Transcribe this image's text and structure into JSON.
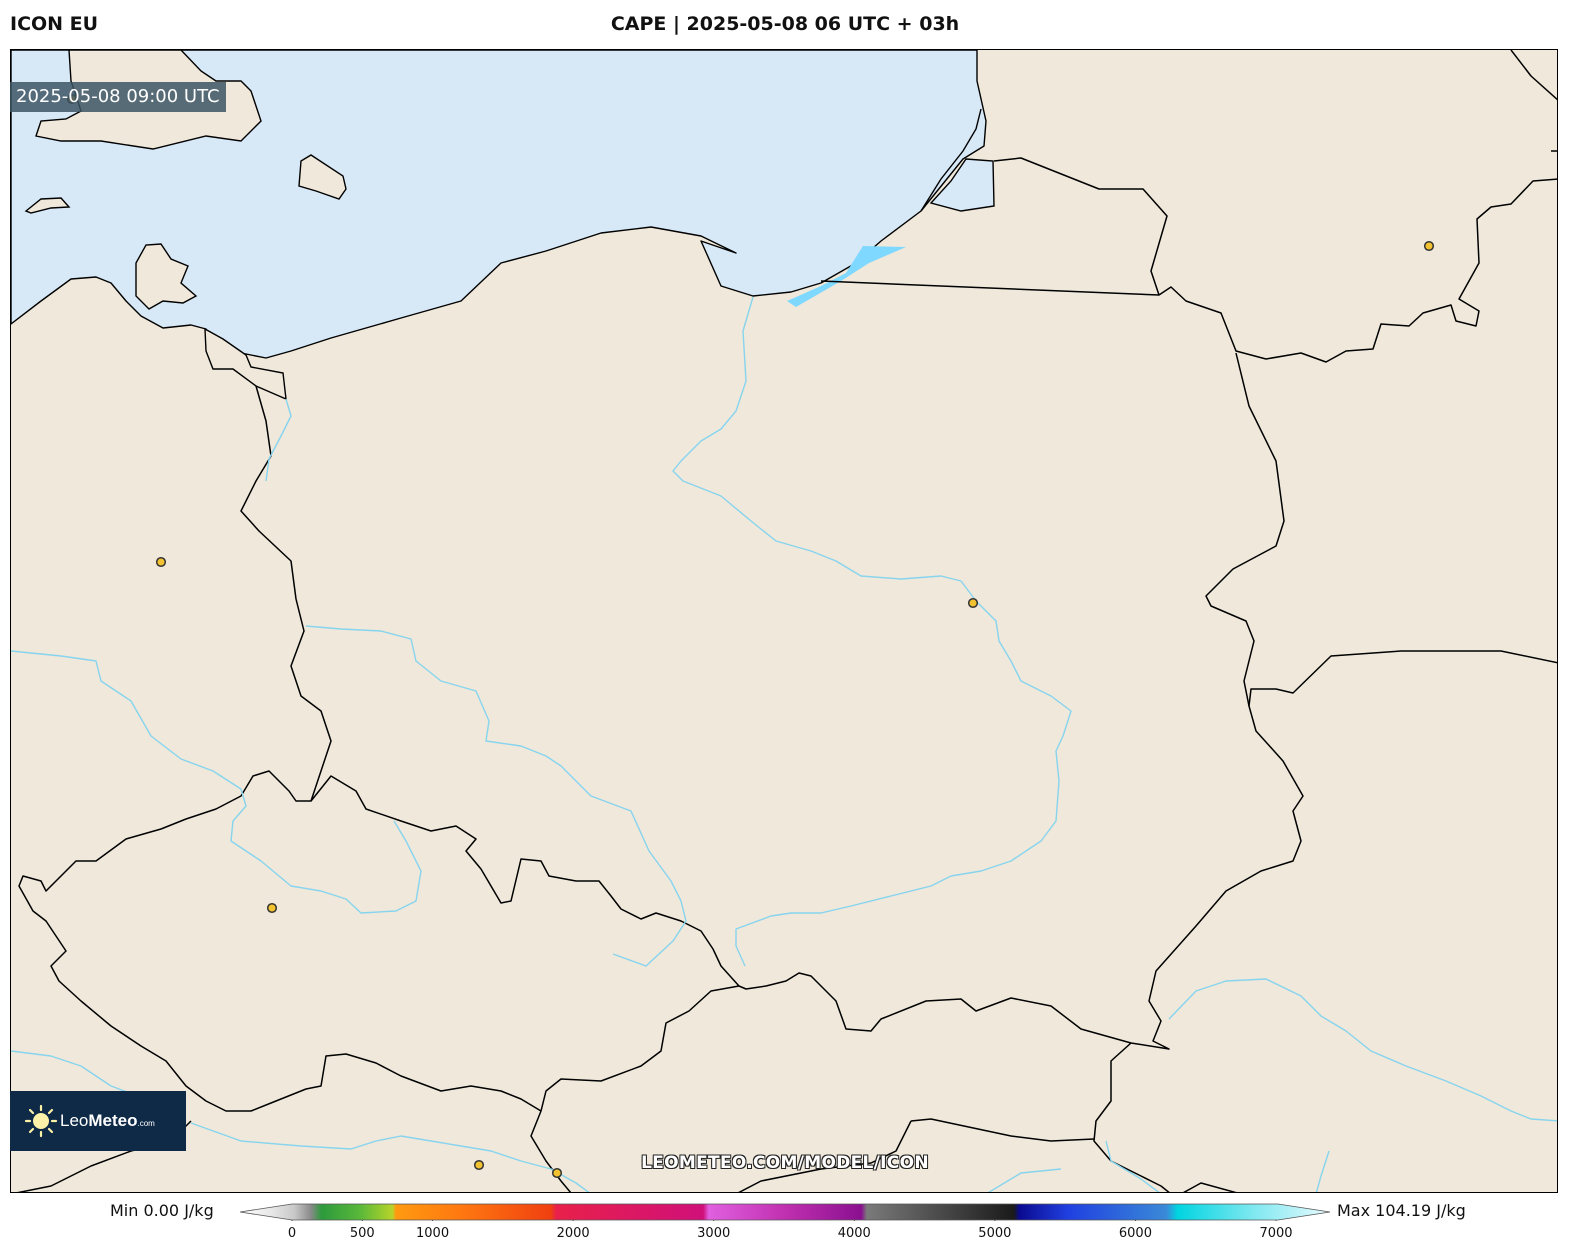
{
  "header": {
    "model": "ICON EU",
    "title": "CAPE | 2025-05-08 06 UTC + 03h"
  },
  "map": {
    "valid_time": "2025-05-08 09:00 UTC",
    "watermark": "LEOMETEO.COM/MODEL/ICON",
    "colors": {
      "land": "#efe8db",
      "sea": "#d7e8f7",
      "borders": "#000000",
      "rivers": "#87d4ee",
      "lagoons": "#7fd8ff",
      "city_marker": "#f2c230"
    }
  },
  "logo": {
    "name_light": "Leo",
    "name_bold": "Meteo",
    "suffix": ".com"
  },
  "legend": {
    "min_label": "Min 0.00 J/kg",
    "max_label": "Max 104.19 J/kg",
    "ticks": [
      "0",
      "500",
      "1000",
      "2000",
      "3000",
      "4000",
      "5000",
      "6000",
      "7000"
    ],
    "tick_values": [
      0,
      500,
      1000,
      2000,
      3000,
      4000,
      5000,
      6000,
      7000
    ],
    "range": [
      0,
      7000
    ]
  }
}
